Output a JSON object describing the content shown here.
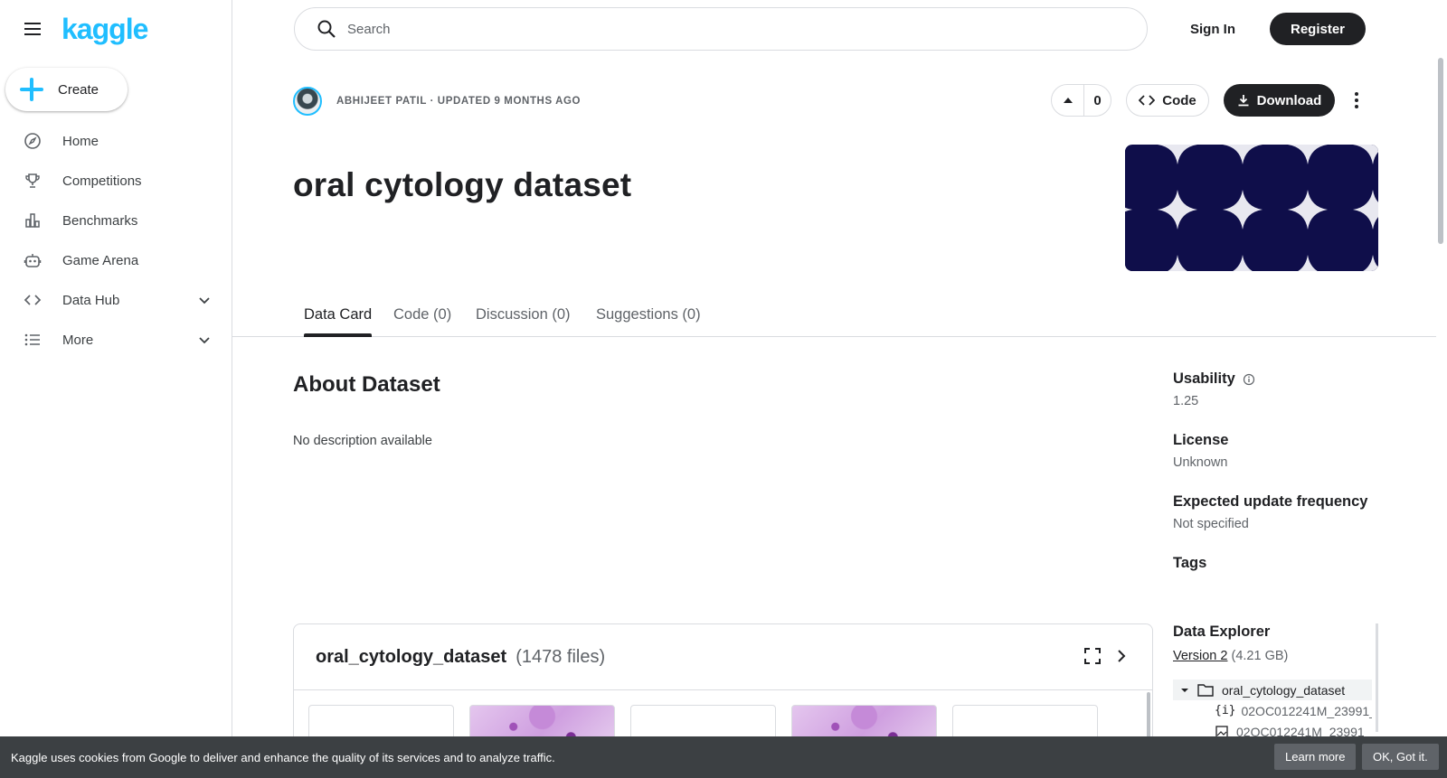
{
  "sidebar": {
    "logo": "kaggle",
    "create_label": "Create",
    "items": [
      {
        "label": "Home",
        "icon": "compass-icon"
      },
      {
        "label": "Competitions",
        "icon": "trophy-icon"
      },
      {
        "label": "Benchmarks",
        "icon": "bar-chart-icon"
      },
      {
        "label": "Game Arena",
        "icon": "robot-icon"
      },
      {
        "label": "Data Hub",
        "icon": "code-brackets-icon",
        "expandable": true
      },
      {
        "label": "More",
        "icon": "list-icon",
        "expandable": true
      }
    ]
  },
  "header": {
    "search_placeholder": "Search",
    "signin_label": "Sign In",
    "register_label": "Register"
  },
  "dataset": {
    "author_line": "ABHIJEET PATIL · UPDATED 9 MONTHS AGO",
    "vote_count": "0",
    "code_label": "Code",
    "download_label": "Download",
    "title": "oral cytology dataset",
    "banner_colors": {
      "background": "#0f0e4a",
      "star": "#e8e8f0"
    }
  },
  "tabs": [
    {
      "label": "Data Card",
      "active": true
    },
    {
      "label": "Code (0)"
    },
    {
      "label": "Discussion (0)"
    },
    {
      "label": "Suggestions (0)"
    }
  ],
  "about": {
    "heading": "About Dataset",
    "description": "No description available"
  },
  "meta": {
    "usability_label": "Usability",
    "usability_value": "1.25",
    "license_label": "License",
    "license_value": "Unknown",
    "frequency_label": "Expected update frequency",
    "frequency_value": "Not specified",
    "tags_label": "Tags"
  },
  "data_explorer": {
    "heading": "Data Explorer",
    "version_link": "Version 2",
    "version_size": "(4.21 GB)",
    "tree": [
      {
        "name": "oral_cytology_dataset",
        "type": "folder"
      },
      {
        "name": "02OC012241M_23991_",
        "type": "json"
      },
      {
        "name": "02OC012241M_23991",
        "type": "image"
      }
    ]
  },
  "files_panel": {
    "title": "oral_cytology_dataset",
    "count": "(1478 files)"
  },
  "cookie": {
    "text": "Kaggle uses cookies from Google to deliver and enhance the quality of its services and to analyze traffic.",
    "learn_more": "Learn more",
    "ok": "OK, Got it."
  },
  "colors": {
    "accent": "#20beff",
    "primary_button": "#202124",
    "cookie_bar": "#3c4043"
  }
}
